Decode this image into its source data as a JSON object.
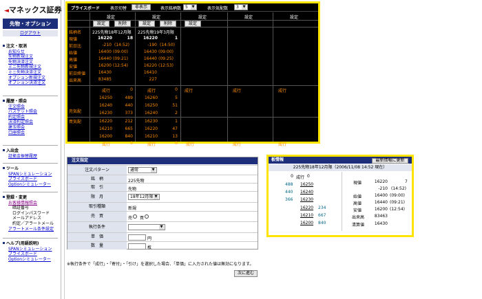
{
  "brand": {
    "name": "マネックス証券",
    "arrow": "◄"
  },
  "sidebar": {
    "section": "先物・オプション",
    "logout": "ログアウト",
    "groups": [
      {
        "title": "注文・取消",
        "items": [
          "お知らせ",
          "先物新規注文",
          "先物決済注文",
          "ミニ先物新規注文",
          "ミニ先物決済注文",
          "オプション新規注文",
          "オプション決済注文"
        ]
      },
      {
        "title": "履歴・照会",
        "items": [
          "注文照会",
          "バスケット照会",
          "約定照会",
          "決済約定照会",
          "建玉照会",
          "口座照会"
        ]
      },
      {
        "title": "入出金",
        "items": [
          "証拠金振替履歴"
        ]
      },
      {
        "title": "ツール",
        "items": [
          "SPANシミュレーション",
          "プライスボード",
          "Optionシミュレーター"
        ]
      },
      {
        "title": "登録・変更",
        "items": [
          "お客様情報照会"
        ],
        "sub": [
          "暗証番号",
          "ログインパスワード",
          "メールアドレス",
          "約定／アラートメール"
        ],
        "tail": "アラートメール条件設定"
      },
      {
        "title": "ヘルプ(用語説明)",
        "items": [
          "SPANシミュレーション",
          "プライスボード",
          "Optionシミュレーター"
        ]
      }
    ]
  },
  "board": {
    "title": "プライスボード",
    "toggle_label": "表示切替",
    "hide_btn": "非表示",
    "count_label": "表示銘柄数",
    "count_val": "5",
    "depth_label": "表示気配数",
    "depth_val": "3",
    "setting": "設定",
    "del": "削除",
    "rowlabels": [
      "銘柄名",
      "現値",
      "前日比",
      "始値",
      "高値",
      "安値",
      "前日終値",
      "出来高"
    ],
    "sell_label": "売気配",
    "buy_label": "買気配",
    "nari": "成行",
    "col1": {
      "name": "225先物18年12月限",
      "price": "16220",
      "price_vol": "18",
      "chg": "-210",
      "chg_t": "(14:52)",
      "open": "16400",
      "open_t": "(09:00)",
      "high": "16440",
      "high_t": "(09:21)",
      "low": "16200",
      "low_t": "(12:54)",
      "prev": "16430",
      "volume": "83485",
      "ask": [
        [
          "成行",
          "0"
        ],
        [
          "16250",
          "489"
        ],
        [
          "16240",
          "440"
        ],
        [
          "16230",
          "373"
        ]
      ],
      "bid": [
        [
          "16220",
          "212"
        ],
        [
          "16210",
          "665"
        ],
        [
          "16200",
          "840"
        ],
        [
          "成行",
          "0"
        ]
      ]
    },
    "col2": {
      "name": "225先物19年3月限",
      "price": "16220",
      "price_vol": "1",
      "chg": "-190",
      "chg_t": "(14:50)",
      "open": "16430",
      "open_t": "(09:00)",
      "high": "16440",
      "high_t": "(09:25)",
      "low": "16220",
      "low_t": "(12:53)",
      "prev": "16410",
      "volume": "227",
      "ask": [
        [
          "成行",
          "0"
        ],
        [
          "16260",
          "5"
        ],
        [
          "16250",
          "51"
        ],
        [
          "16240",
          "2"
        ]
      ],
      "bid": [
        [
          "16230",
          "1"
        ],
        [
          "16220",
          "47"
        ],
        [
          "16210",
          "13"
        ],
        [
          "成行",
          "0"
        ]
      ]
    }
  },
  "order": {
    "title": "注文指定",
    "rows": [
      {
        "label": "注文パターン",
        "value": "通常"
      },
      {
        "label": "銘　柄",
        "value": "225先物"
      },
      {
        "label": "取　引",
        "value": "先物"
      },
      {
        "label": "限　月",
        "value": "18年12月限"
      },
      {
        "label": "取引種類",
        "value": "新規"
      },
      {
        "label": "売　買",
        "value": "売",
        "value2": "買"
      },
      {
        "label": "執行条件",
        "value": ""
      },
      {
        "label": "単　価",
        "value": "円"
      },
      {
        "label": "数　量",
        "value": "枚"
      }
    ],
    "note": "※執行条件で「成行」・「寄付」・「引け」を選択した場合、「単価」に入力された値は無効になります。",
    "next": "次に進む"
  },
  "info": {
    "title": "板情報",
    "refresh": "最新情報に更新",
    "header": "225先物18年12月限（2006/11/08 14:52 現在）",
    "book": [
      [
        "",
        "0",
        "成行",
        "0"
      ],
      [
        "488",
        "",
        "16250",
        ""
      ],
      [
        "440",
        "",
        "16240",
        ""
      ],
      [
        "366",
        "",
        "16230",
        ""
      ],
      [
        "",
        "",
        "16220",
        "234"
      ],
      [
        "",
        "",
        "16210",
        "667"
      ],
      [
        "",
        "",
        "16200",
        "840"
      ]
    ],
    "stats": [
      [
        "現値",
        "16220",
        "7"
      ],
      [
        "",
        "-210",
        "(14:52)"
      ],
      [
        "始値",
        "16400",
        "(09:00)"
      ],
      [
        "高値",
        "16440",
        "(09:21)"
      ],
      [
        "安値",
        "16200",
        "(12:54)"
      ],
      [
        "出来高",
        "83463",
        ""
      ],
      [
        "清算値",
        "16430",
        ""
      ]
    ]
  }
}
